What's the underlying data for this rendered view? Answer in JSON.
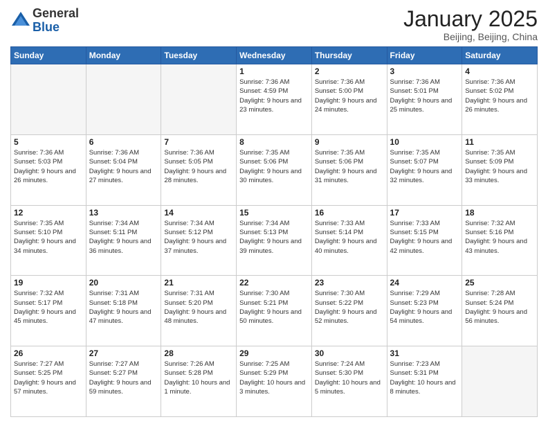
{
  "logo": {
    "general": "General",
    "blue": "Blue"
  },
  "header": {
    "month": "January 2025",
    "location": "Beijing, Beijing, China"
  },
  "weekdays": [
    "Sunday",
    "Monday",
    "Tuesday",
    "Wednesday",
    "Thursday",
    "Friday",
    "Saturday"
  ],
  "weeks": [
    [
      {
        "day": "",
        "info": ""
      },
      {
        "day": "",
        "info": ""
      },
      {
        "day": "",
        "info": ""
      },
      {
        "day": "1",
        "info": "Sunrise: 7:36 AM\nSunset: 4:59 PM\nDaylight: 9 hours\nand 23 minutes."
      },
      {
        "day": "2",
        "info": "Sunrise: 7:36 AM\nSunset: 5:00 PM\nDaylight: 9 hours\nand 24 minutes."
      },
      {
        "day": "3",
        "info": "Sunrise: 7:36 AM\nSunset: 5:01 PM\nDaylight: 9 hours\nand 25 minutes."
      },
      {
        "day": "4",
        "info": "Sunrise: 7:36 AM\nSunset: 5:02 PM\nDaylight: 9 hours\nand 26 minutes."
      }
    ],
    [
      {
        "day": "5",
        "info": "Sunrise: 7:36 AM\nSunset: 5:03 PM\nDaylight: 9 hours\nand 26 minutes."
      },
      {
        "day": "6",
        "info": "Sunrise: 7:36 AM\nSunset: 5:04 PM\nDaylight: 9 hours\nand 27 minutes."
      },
      {
        "day": "7",
        "info": "Sunrise: 7:36 AM\nSunset: 5:05 PM\nDaylight: 9 hours\nand 28 minutes."
      },
      {
        "day": "8",
        "info": "Sunrise: 7:35 AM\nSunset: 5:06 PM\nDaylight: 9 hours\nand 30 minutes."
      },
      {
        "day": "9",
        "info": "Sunrise: 7:35 AM\nSunset: 5:06 PM\nDaylight: 9 hours\nand 31 minutes."
      },
      {
        "day": "10",
        "info": "Sunrise: 7:35 AM\nSunset: 5:07 PM\nDaylight: 9 hours\nand 32 minutes."
      },
      {
        "day": "11",
        "info": "Sunrise: 7:35 AM\nSunset: 5:09 PM\nDaylight: 9 hours\nand 33 minutes."
      }
    ],
    [
      {
        "day": "12",
        "info": "Sunrise: 7:35 AM\nSunset: 5:10 PM\nDaylight: 9 hours\nand 34 minutes."
      },
      {
        "day": "13",
        "info": "Sunrise: 7:34 AM\nSunset: 5:11 PM\nDaylight: 9 hours\nand 36 minutes."
      },
      {
        "day": "14",
        "info": "Sunrise: 7:34 AM\nSunset: 5:12 PM\nDaylight: 9 hours\nand 37 minutes."
      },
      {
        "day": "15",
        "info": "Sunrise: 7:34 AM\nSunset: 5:13 PM\nDaylight: 9 hours\nand 39 minutes."
      },
      {
        "day": "16",
        "info": "Sunrise: 7:33 AM\nSunset: 5:14 PM\nDaylight: 9 hours\nand 40 minutes."
      },
      {
        "day": "17",
        "info": "Sunrise: 7:33 AM\nSunset: 5:15 PM\nDaylight: 9 hours\nand 42 minutes."
      },
      {
        "day": "18",
        "info": "Sunrise: 7:32 AM\nSunset: 5:16 PM\nDaylight: 9 hours\nand 43 minutes."
      }
    ],
    [
      {
        "day": "19",
        "info": "Sunrise: 7:32 AM\nSunset: 5:17 PM\nDaylight: 9 hours\nand 45 minutes."
      },
      {
        "day": "20",
        "info": "Sunrise: 7:31 AM\nSunset: 5:18 PM\nDaylight: 9 hours\nand 47 minutes."
      },
      {
        "day": "21",
        "info": "Sunrise: 7:31 AM\nSunset: 5:20 PM\nDaylight: 9 hours\nand 48 minutes."
      },
      {
        "day": "22",
        "info": "Sunrise: 7:30 AM\nSunset: 5:21 PM\nDaylight: 9 hours\nand 50 minutes."
      },
      {
        "day": "23",
        "info": "Sunrise: 7:30 AM\nSunset: 5:22 PM\nDaylight: 9 hours\nand 52 minutes."
      },
      {
        "day": "24",
        "info": "Sunrise: 7:29 AM\nSunset: 5:23 PM\nDaylight: 9 hours\nand 54 minutes."
      },
      {
        "day": "25",
        "info": "Sunrise: 7:28 AM\nSunset: 5:24 PM\nDaylight: 9 hours\nand 56 minutes."
      }
    ],
    [
      {
        "day": "26",
        "info": "Sunrise: 7:27 AM\nSunset: 5:25 PM\nDaylight: 9 hours\nand 57 minutes."
      },
      {
        "day": "27",
        "info": "Sunrise: 7:27 AM\nSunset: 5:27 PM\nDaylight: 9 hours\nand 59 minutes."
      },
      {
        "day": "28",
        "info": "Sunrise: 7:26 AM\nSunset: 5:28 PM\nDaylight: 10 hours\nand 1 minute."
      },
      {
        "day": "29",
        "info": "Sunrise: 7:25 AM\nSunset: 5:29 PM\nDaylight: 10 hours\nand 3 minutes."
      },
      {
        "day": "30",
        "info": "Sunrise: 7:24 AM\nSunset: 5:30 PM\nDaylight: 10 hours\nand 5 minutes."
      },
      {
        "day": "31",
        "info": "Sunrise: 7:23 AM\nSunset: 5:31 PM\nDaylight: 10 hours\nand 8 minutes."
      },
      {
        "day": "",
        "info": ""
      }
    ]
  ]
}
